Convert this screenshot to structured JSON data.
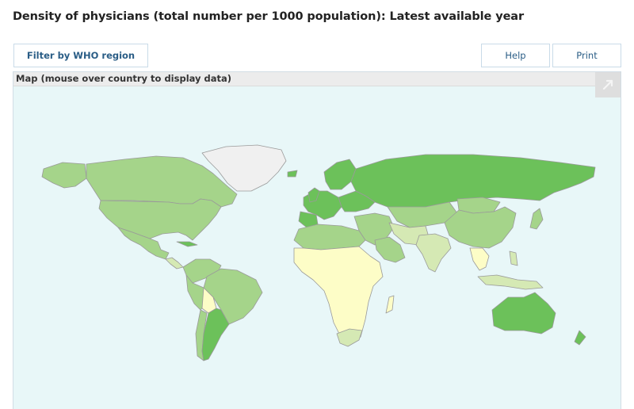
{
  "page": {
    "title": "Density of physicians (total number per 1000 population): Latest available year"
  },
  "toolbar": {
    "filter_label": "Filter by WHO region",
    "help_label": "Help",
    "print_label": "Print"
  },
  "map": {
    "header": "Map (mouse over country to display data)",
    "expand_icon": "expand-arrow-icon",
    "colors": {
      "background": "#e8f7f8",
      "highest": "#6cc15a",
      "high": "#a5d48a",
      "medium": "#d5e9b4",
      "low": "#fdfdc7",
      "no_data": "#f0f0f0",
      "border": "#9a9a9a"
    }
  }
}
